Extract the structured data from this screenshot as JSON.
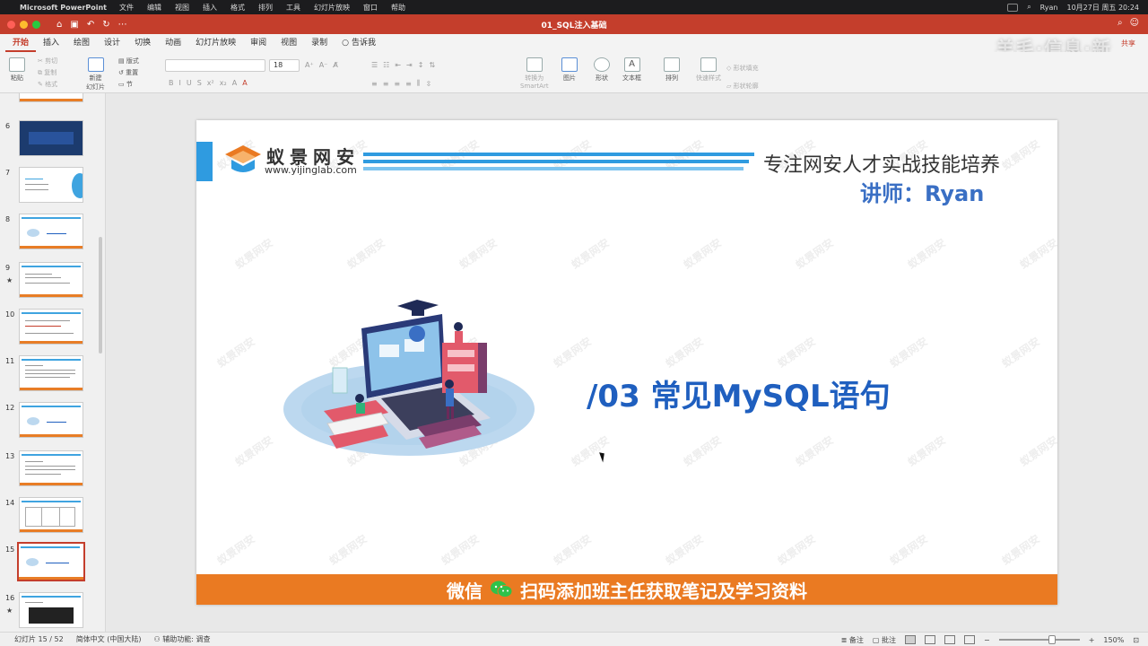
{
  "menubar": {
    "app_name": "Microsoft PowerPoint",
    "items": [
      "文件",
      "编辑",
      "视图",
      "插入",
      "格式",
      "排列",
      "工具",
      "幻灯片放映",
      "窗口",
      "帮助"
    ],
    "user": "Ryan",
    "datetime": "10月27日 周五  20:24"
  },
  "titlebar": {
    "doc_title": "01_SQL注入基础"
  },
  "ribbon": {
    "tabs": [
      "开始",
      "插入",
      "绘图",
      "设计",
      "切换",
      "动画",
      "幻灯片放映",
      "审阅",
      "视图",
      "录制"
    ],
    "active_tab": "开始",
    "tell_me": "告诉我",
    "share": "共享",
    "clipboard": {
      "paste": "粘贴",
      "cut": "剪切",
      "copy": "复制",
      "format": "格式"
    },
    "slides": {
      "new_slide": "新建\n幻灯片",
      "layout": "版式",
      "reset": "重置",
      "section": "节"
    },
    "font_size": "18",
    "insert": {
      "picture": "图片",
      "shapes": "形状",
      "textbox": "文本框"
    },
    "arrange": "排列",
    "quick_styles": "快速样式",
    "convert_smartart": "转换为\nSmartArt",
    "shape_fill": "形状填充",
    "shape_outline": "形状轮廓"
  },
  "thumbnails": [
    {
      "num": "6",
      "star": false,
      "style": "dark"
    },
    {
      "num": "7",
      "star": false,
      "style": "contents"
    },
    {
      "num": "8",
      "star": false,
      "style": "title"
    },
    {
      "num": "9",
      "star": true,
      "style": "text"
    },
    {
      "num": "10",
      "star": false,
      "style": "text"
    },
    {
      "num": "11",
      "star": false,
      "style": "text"
    },
    {
      "num": "12",
      "star": false,
      "style": "title"
    },
    {
      "num": "13",
      "star": false,
      "style": "text"
    },
    {
      "num": "14",
      "star": false,
      "style": "table"
    },
    {
      "num": "15",
      "star": false,
      "style": "title",
      "selected": true
    },
    {
      "num": "16",
      "star": true,
      "style": "code"
    }
  ],
  "slide": {
    "logo_text": "蚁景网安",
    "logo_url": "www.yijinglab.com",
    "slogan": "专注网安人才实战技能培养",
    "lecturer": "讲师：Ryan",
    "heading": "/03 常见MySQL语句",
    "watermark": "蚁景网安",
    "bottom_left": "微信",
    "bottom_right": "扫码添加班主任获取笔记及学习资料"
  },
  "statusbar": {
    "slide_pos": "幻灯片 15 / 52",
    "language": "简体中文 (中国大陆)",
    "accessibility": "辅助功能: 调查",
    "notes": "备注",
    "comments": "批注",
    "zoom": "150%"
  },
  "overlay_watermark": "羊毛·信息·新",
  "colors": {
    "accent": "#c43e2c",
    "slide_blue": "#2f9be0",
    "heading_blue": "#1f5fbf",
    "orange_bar": "#ea7a22"
  }
}
